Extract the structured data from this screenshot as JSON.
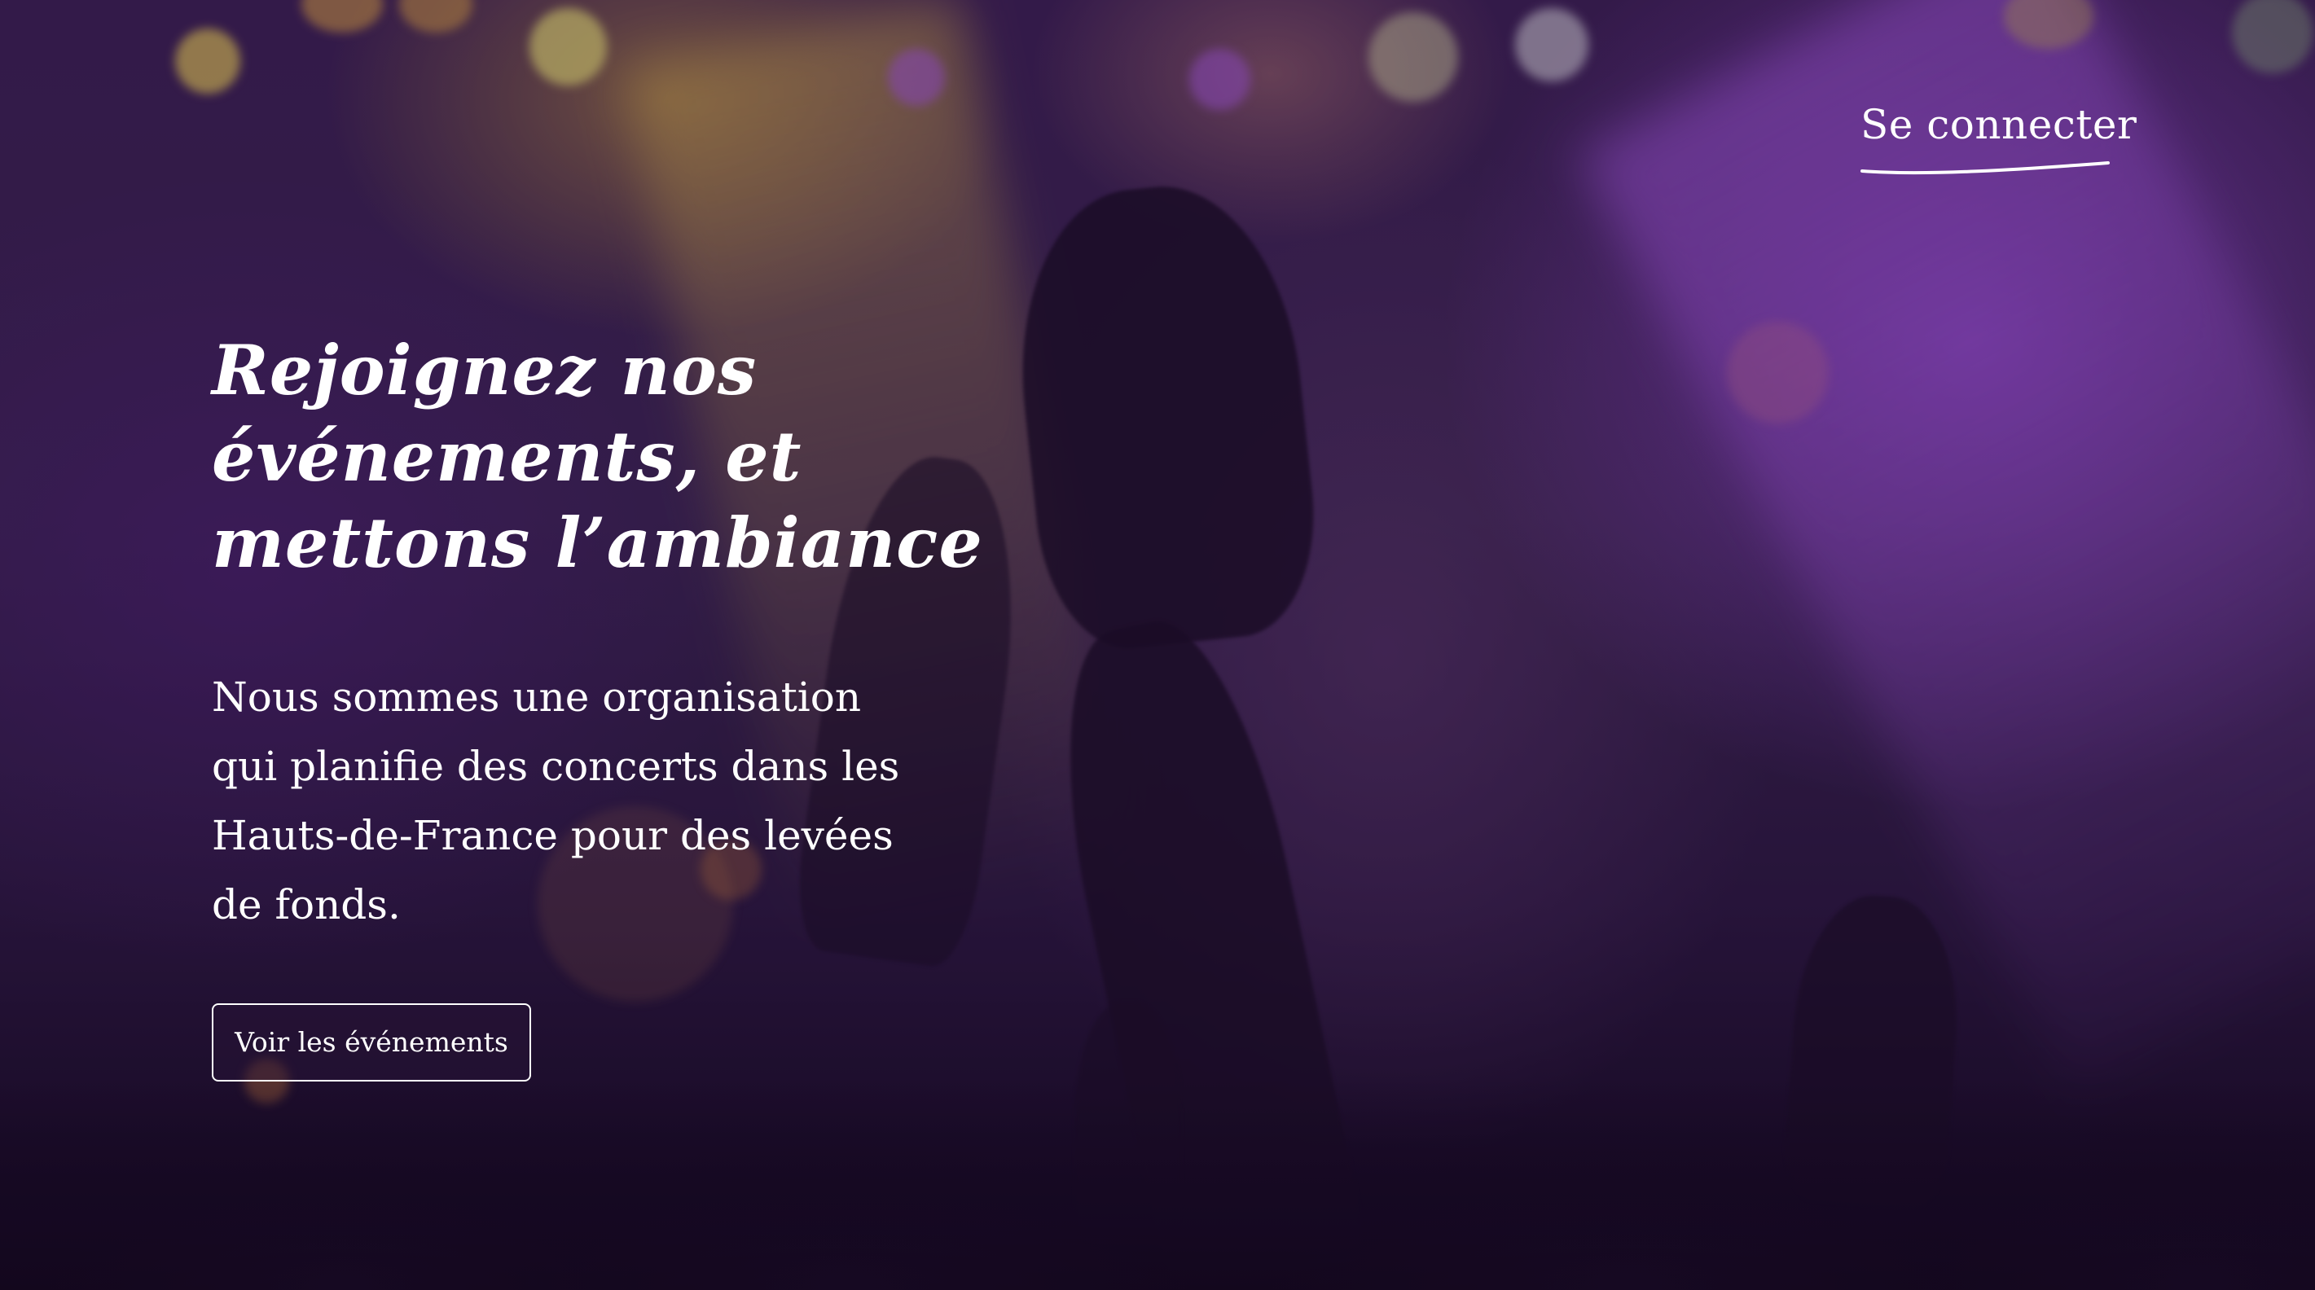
{
  "header": {
    "login_label": "Se connecter"
  },
  "hero": {
    "title": "Rejoignez nos événements, et mettons l’ambiance",
    "description": "Nous sommes une organisation qui planifie des concerts dans les Hauts-de-France pour des levées de fonds.",
    "cta_label": "Voir les événements"
  },
  "colors": {
    "text": "#ffffff",
    "background_dark": "#14071f",
    "accent_purple": "#9646d2",
    "accent_gold": "#cda03c"
  }
}
